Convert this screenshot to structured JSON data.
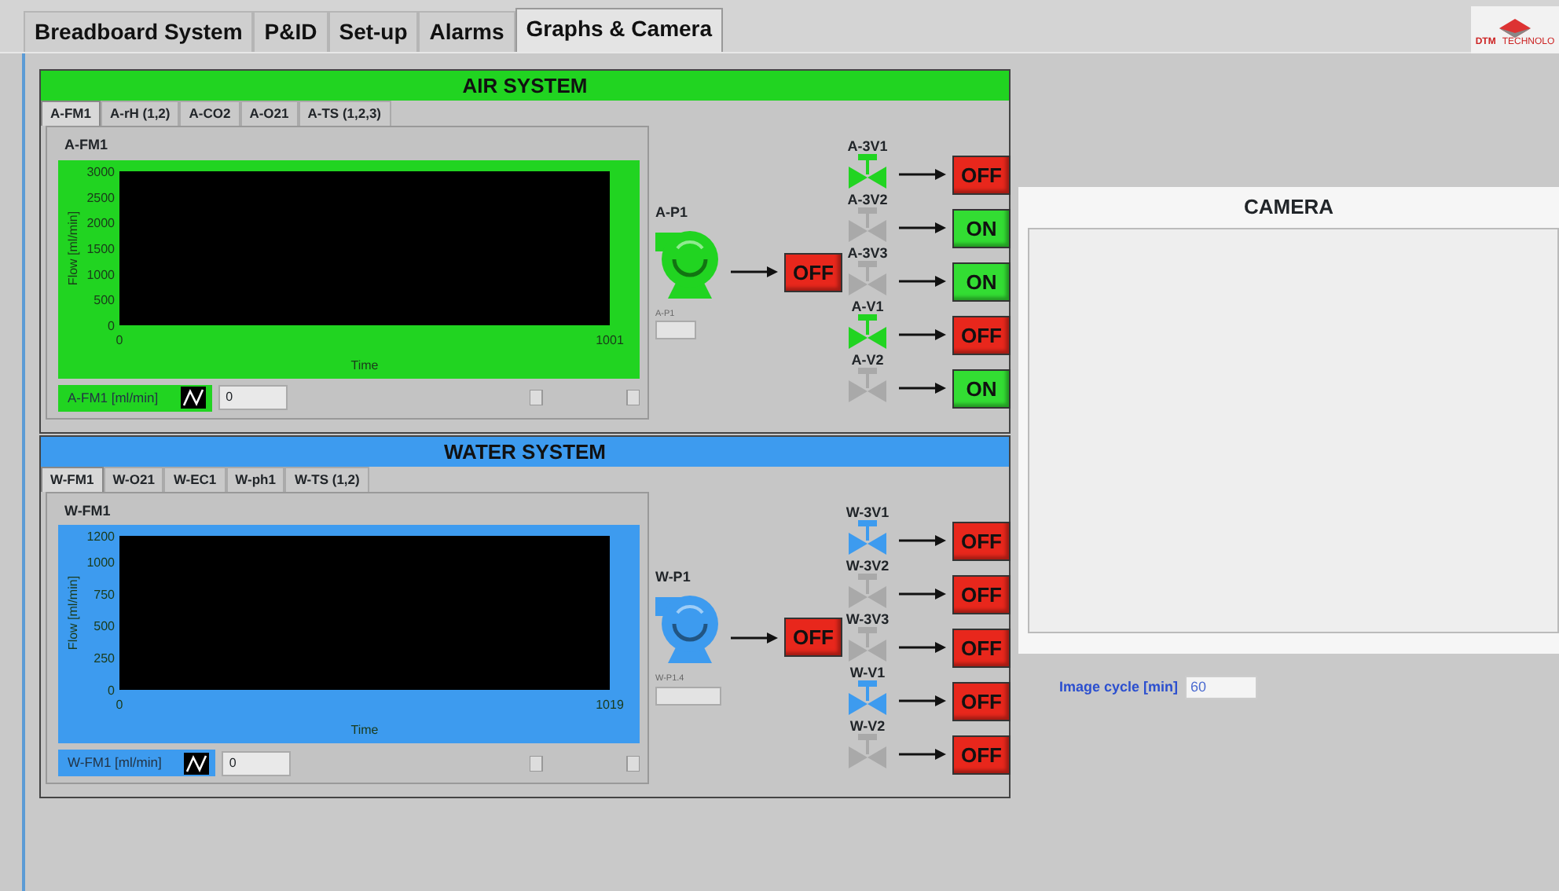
{
  "tabs": [
    {
      "label": "Breadboard System",
      "selected": false
    },
    {
      "label": "P&ID",
      "selected": false
    },
    {
      "label": "Set-up",
      "selected": false
    },
    {
      "label": "Alarms",
      "selected": false
    },
    {
      "label": "Graphs & Camera",
      "selected": true
    }
  ],
  "logo": {
    "mark": "DTM",
    "name": "TECHNOLO"
  },
  "systems": [
    {
      "title": "AIR SYSTEM",
      "color": "#21d421",
      "tabs": [
        {
          "label": "A-FM1",
          "selected": true
        },
        {
          "label": "A-rH (1,2)",
          "selected": false
        },
        {
          "label": "A-CO2",
          "selected": false
        },
        {
          "label": "A-O21",
          "selected": false
        },
        {
          "label": "A-TS (1,2,3)",
          "selected": false
        }
      ],
      "graph": {
        "label": "A-FM1",
        "legend": "A-FM1 [ml/min]",
        "value": "0",
        "chart_data": {
          "type": "line",
          "xlabel": "Time",
          "ylabel": "Flow [ml/min]",
          "xlim": [
            0,
            1001
          ],
          "ylim": [
            0,
            3000
          ],
          "xticks": [
            0,
            1001
          ],
          "yticks": [
            0,
            500,
            1000,
            1500,
            2000,
            2500,
            3000
          ]
        }
      },
      "pump": {
        "label": "A-P1",
        "indicator_label": "A-P1",
        "on": false,
        "button": "OFF"
      },
      "valves": [
        {
          "label": "A-3V1",
          "open": true,
          "on": false,
          "button": "OFF"
        },
        {
          "label": "A-3V2",
          "open": false,
          "on": true,
          "button": "ON"
        },
        {
          "label": "A-3V3",
          "open": false,
          "on": true,
          "button": "ON"
        },
        {
          "label": "A-V1",
          "open": true,
          "on": false,
          "button": "OFF"
        },
        {
          "label": "A-V2",
          "open": false,
          "on": true,
          "button": "ON"
        }
      ]
    },
    {
      "title": "WATER SYSTEM",
      "color": "#3d9bef",
      "tabs": [
        {
          "label": "W-FM1",
          "selected": true
        },
        {
          "label": "W-O21",
          "selected": false
        },
        {
          "label": "W-EC1",
          "selected": false
        },
        {
          "label": "W-ph1",
          "selected": false
        },
        {
          "label": "W-TS (1,2)",
          "selected": false
        }
      ],
      "graph": {
        "label": "W-FM1",
        "legend": "W-FM1 [ml/min]",
        "value": "0",
        "chart_data": {
          "type": "line",
          "xlabel": "Time",
          "ylabel": "Flow [ml/min]",
          "xlim": [
            0,
            1019
          ],
          "ylim": [
            0,
            1200
          ],
          "xticks": [
            0,
            1019
          ],
          "yticks": [
            0,
            250,
            500,
            750,
            1000,
            1200
          ]
        }
      },
      "pump": {
        "label": "W-P1",
        "indicator_label": "W-P1.4",
        "on": false,
        "button": "OFF"
      },
      "valves": [
        {
          "label": "W-3V1",
          "open": true,
          "on": false,
          "button": "OFF"
        },
        {
          "label": "W-3V2",
          "open": false,
          "on": false,
          "button": "OFF"
        },
        {
          "label": "W-3V3",
          "open": false,
          "on": false,
          "button": "OFF"
        },
        {
          "label": "W-V1",
          "open": true,
          "on": false,
          "button": "OFF"
        },
        {
          "label": "W-V2",
          "open": false,
          "on": false,
          "button": "OFF"
        }
      ]
    }
  ],
  "camera": {
    "title": "CAMERA"
  },
  "image_cycle": {
    "label": "Image cycle [min]",
    "value": "60"
  }
}
